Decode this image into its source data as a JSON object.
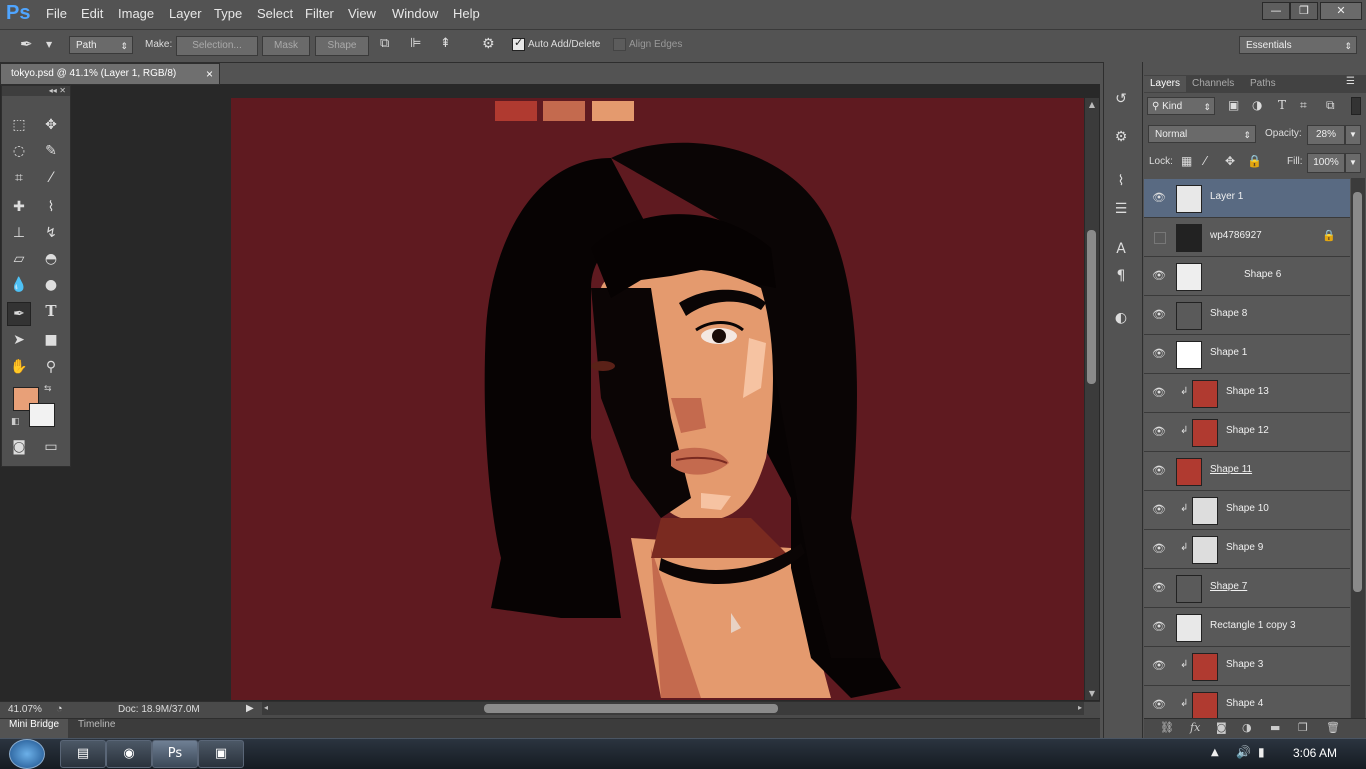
{
  "app": {
    "logo": "Ps"
  },
  "menu": [
    "File",
    "Edit",
    "Image",
    "Layer",
    "Type",
    "Select",
    "Filter",
    "View",
    "Window",
    "Help"
  ],
  "window_controls": {
    "minimize": "—",
    "restore": "❐",
    "close": "✕"
  },
  "options": {
    "mode_select": "Path",
    "make_label": "Make:",
    "selection_btn": "Selection...",
    "mask_btn": "Mask",
    "shape_btn": "Shape",
    "auto_add_label": "Auto Add/Delete",
    "auto_add_checked": true,
    "align_edges_label": "Align Edges",
    "align_edges_checked": false,
    "workspace": "Essentials"
  },
  "document": {
    "tab_title": "tokyo.psd @ 41.1% (Layer 1, RGB/8)",
    "close": "×"
  },
  "canvas": {
    "background": "#5f1a20",
    "swatches": [
      "#b03a30",
      "#c46a4e",
      "#e49a6e"
    ]
  },
  "colors": {
    "foreground": "#e8a078",
    "background": "#f2f2f2"
  },
  "status": {
    "zoom": "41.07%",
    "doc": "Doc: 18.9M/37.0M"
  },
  "bottom_tabs": [
    "Mini Bridge",
    "Timeline"
  ],
  "panel": {
    "tabs": [
      "Layers",
      "Channels",
      "Paths"
    ],
    "active_tab": "Layers",
    "kind": "Kind",
    "blend_mode": "Normal",
    "opacity_label": "Opacity:",
    "opacity": "28%",
    "lock_label": "Lock:",
    "fill_label": "Fill:",
    "fill": "100%"
  },
  "layers": [
    {
      "name": "Layer 1",
      "visible": true,
      "selected": true,
      "locked": false,
      "underline": false,
      "clipped": false
    },
    {
      "name": "wp4786927",
      "visible": false,
      "selected": false,
      "locked": true,
      "underline": false,
      "clipped": false
    },
    {
      "name": "Shape 6",
      "visible": true,
      "selected": false,
      "locked": false,
      "underline": false,
      "clipped": false
    },
    {
      "name": "Shape 8",
      "visible": true,
      "selected": false,
      "locked": false,
      "underline": false,
      "clipped": false
    },
    {
      "name": "Shape 1",
      "visible": true,
      "selected": false,
      "locked": false,
      "underline": false,
      "clipped": false
    },
    {
      "name": "Shape 13",
      "visible": true,
      "selected": false,
      "locked": false,
      "underline": false,
      "clipped": true
    },
    {
      "name": "Shape 12",
      "visible": true,
      "selected": false,
      "locked": false,
      "underline": false,
      "clipped": true
    },
    {
      "name": "Shape 11",
      "visible": true,
      "selected": false,
      "locked": false,
      "underline": true,
      "clipped": false
    },
    {
      "name": "Shape 10",
      "visible": true,
      "selected": false,
      "locked": false,
      "underline": false,
      "clipped": true
    },
    {
      "name": "Shape 9",
      "visible": true,
      "selected": false,
      "locked": false,
      "underline": false,
      "clipped": true
    },
    {
      "name": "Shape 7",
      "visible": true,
      "selected": false,
      "locked": false,
      "underline": true,
      "clipped": false
    },
    {
      "name": "Rectangle 1 copy 3",
      "visible": true,
      "selected": false,
      "locked": false,
      "underline": false,
      "clipped": false
    },
    {
      "name": "Shape 3",
      "visible": true,
      "selected": false,
      "locked": false,
      "underline": false,
      "clipped": true
    },
    {
      "name": "Shape 4",
      "visible": true,
      "selected": false,
      "locked": false,
      "underline": false,
      "clipped": true
    }
  ],
  "taskbar": {
    "time": "3:06 AM"
  }
}
